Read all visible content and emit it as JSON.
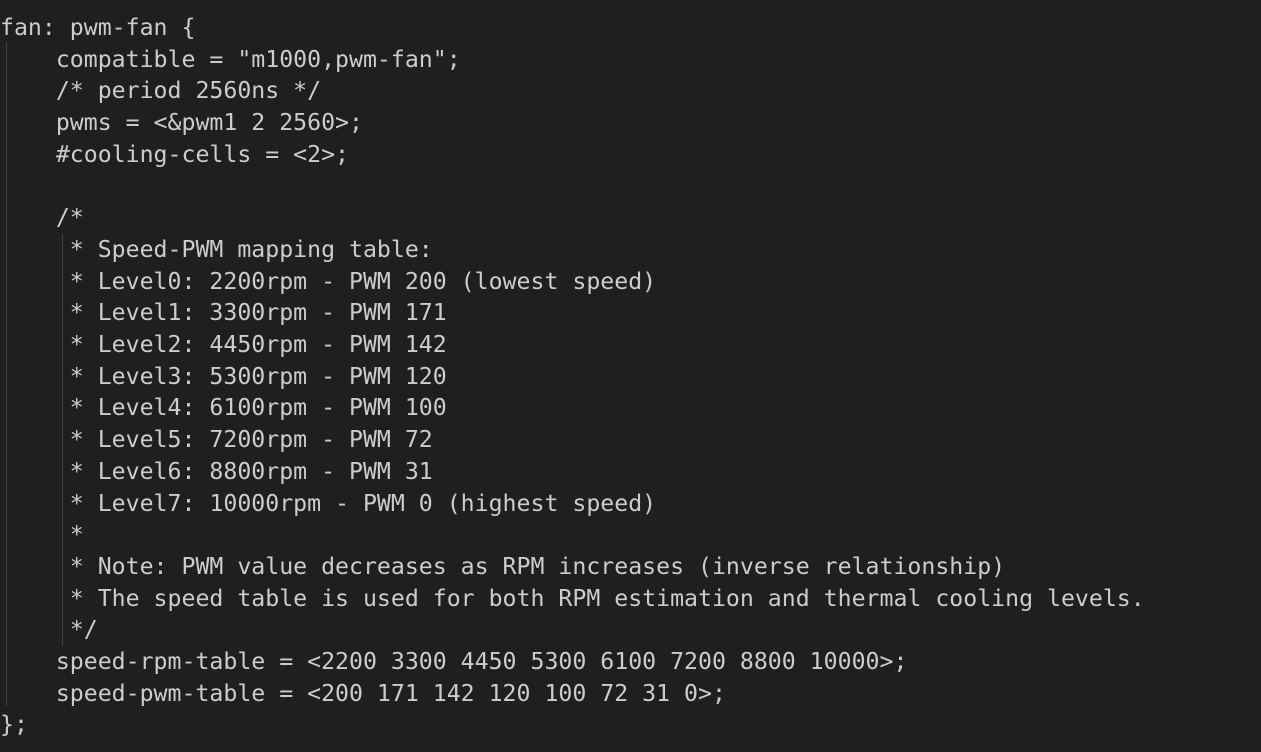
{
  "editor": {
    "lines": [
      "fan: pwm-fan {",
      "    compatible = \"m1000,pwm-fan\";",
      "    /* period 2560ns */",
      "    pwms = <&pwm1 2 2560>;",
      "    #cooling-cells = <2>;",
      "",
      "    /*",
      "     * Speed-PWM mapping table:",
      "     * Level0: 2200rpm - PWM 200 (lowest speed)",
      "     * Level1: 3300rpm - PWM 171",
      "     * Level2: 4450rpm - PWM 142",
      "     * Level3: 5300rpm - PWM 120",
      "     * Level4: 6100rpm - PWM 100",
      "     * Level5: 7200rpm - PWM 72",
      "     * Level6: 8800rpm - PWM 31",
      "     * Level7: 10000rpm - PWM 0 (highest speed)",
      "     *",
      "     * Note: PWM value decreases as RPM increases (inverse relationship)",
      "     * The speed table is used for both RPM estimation and thermal cooling levels.",
      "     */",
      "    speed-rpm-table = <2200 3300 4450 5300 6100 7200 8800 10000>;",
      "    speed-pwm-table = <200 171 142 120 100 72 31 0>;",
      "};"
    ],
    "colors": {
      "background": "#1f1f1f",
      "text": "#cccccc",
      "indent_guide": "#404040"
    }
  }
}
